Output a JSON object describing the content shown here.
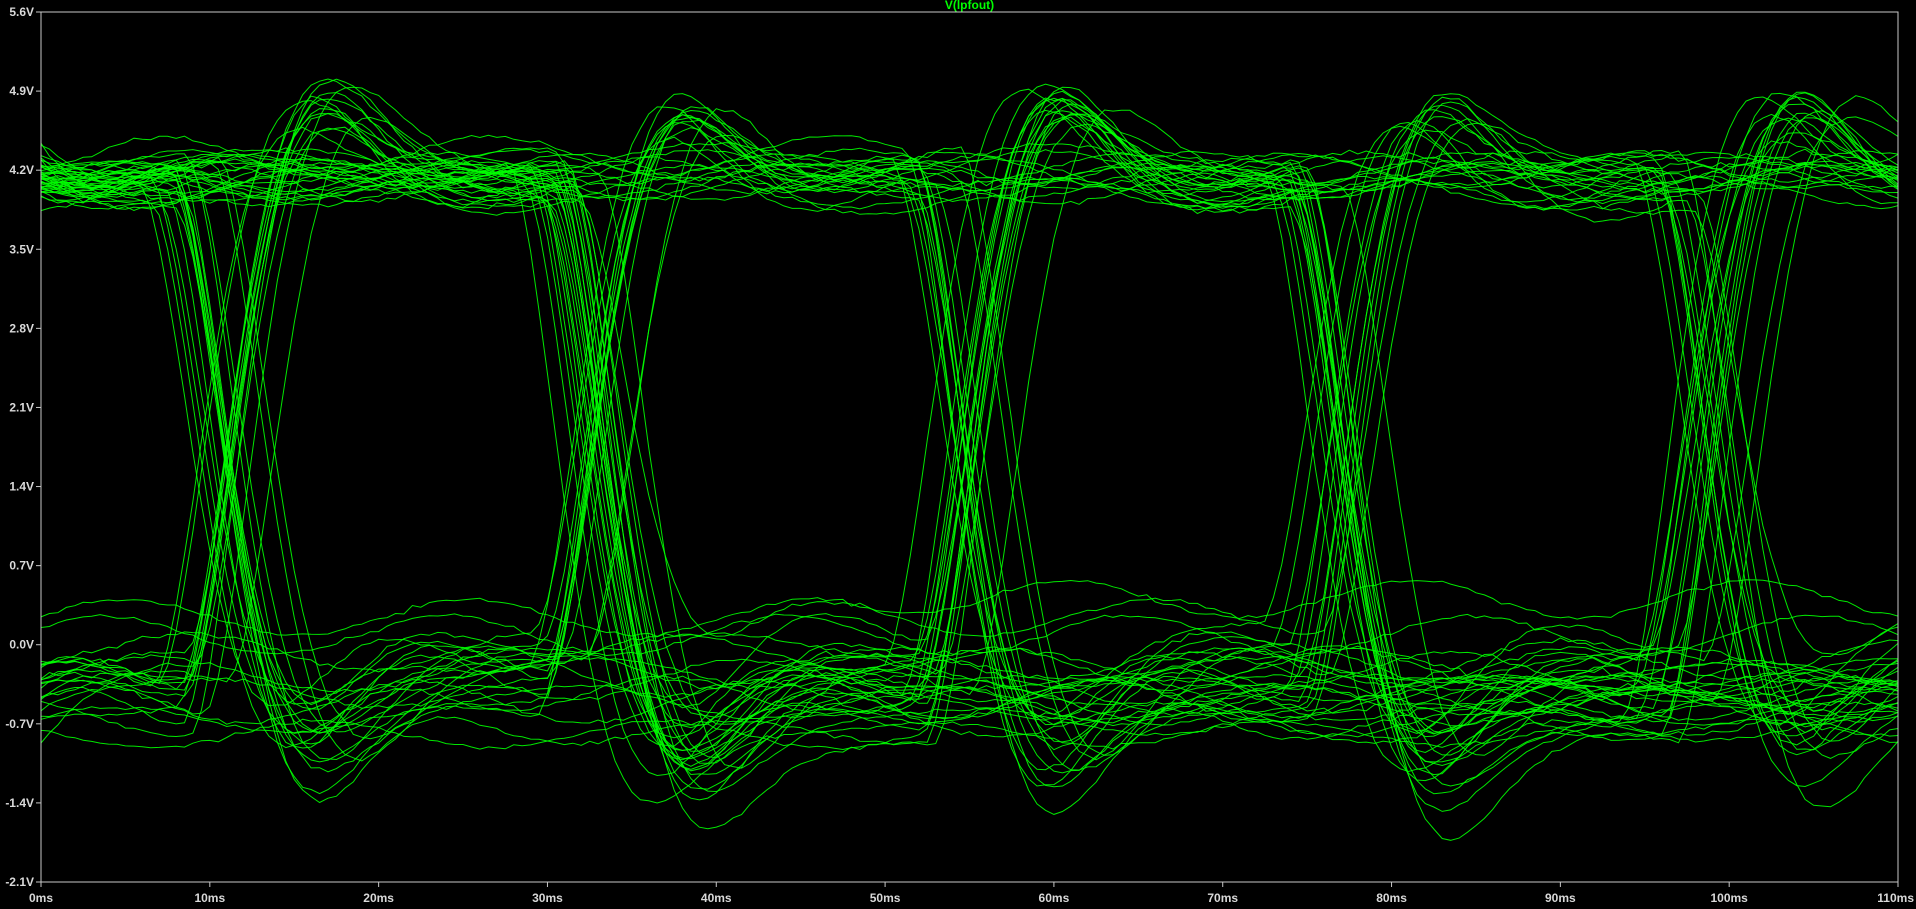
{
  "chart_data": {
    "type": "line",
    "title": "V(lpfout)",
    "xlabel": "",
    "ylabel": "",
    "xlim": [
      0,
      110
    ],
    "ylim": [
      -2.1,
      5.6
    ],
    "x_ticks": [
      0,
      10,
      20,
      30,
      40,
      50,
      60,
      70,
      80,
      90,
      100,
      110
    ],
    "x_tick_labels": [
      "0ms",
      "10ms",
      "20ms",
      "30ms",
      "40ms",
      "50ms",
      "60ms",
      "70ms",
      "80ms",
      "90ms",
      "100ms",
      "110ms"
    ],
    "y_ticks": [
      -2.1,
      -1.4,
      -0.7,
      0.0,
      0.7,
      1.4,
      2.1,
      2.8,
      3.5,
      4.2,
      4.9,
      5.6
    ],
    "y_tick_labels": [
      "-2.1V",
      "-1.4V",
      "-0.7V",
      "0.0V",
      "0.7V",
      "1.4V",
      "2.1V",
      "2.8V",
      "3.5V",
      "4.2V",
      "4.9V",
      "5.6V"
    ],
    "grid": false,
    "legend": "none",
    "x_unit": "ms",
    "y_unit": "V",
    "bit_period_ms": 22,
    "eye_crossings_ms": [
      11,
      33,
      55,
      77,
      99
    ],
    "levels_V": {
      "high_settled": 4.1,
      "high_peak": 5.0,
      "low": -0.2,
      "crossing": 1.95
    },
    "series": [
      {
        "values": [
          [
            0,
            4.9
          ],
          [
            11,
            1.95
          ],
          [
            22,
            4.95
          ],
          [
            33,
            1.95
          ],
          [
            44,
            4.85
          ],
          [
            55,
            1.95
          ],
          [
            66,
            4.95
          ],
          [
            77,
            1.95
          ],
          [
            88,
            4.9
          ],
          [
            99,
            1.95
          ],
          [
            110,
            5.0
          ]
        ]
      },
      {
        "values": [
          [
            0,
            -0.9
          ],
          [
            11,
            1.95
          ],
          [
            22,
            0.0
          ],
          [
            33,
            1.95
          ],
          [
            44,
            -1.3
          ],
          [
            55,
            1.95
          ],
          [
            66,
            -0.3
          ],
          [
            77,
            1.95
          ],
          [
            88,
            -1.2
          ],
          [
            99,
            1.95
          ],
          [
            110,
            -0.4
          ]
        ]
      },
      {
        "values": [
          [
            0,
            4.1
          ],
          [
            22,
            4.15
          ],
          [
            44,
            4.1
          ],
          [
            66,
            4.15
          ],
          [
            88,
            4.1
          ],
          [
            110,
            4.15
          ]
        ]
      },
      {
        "values": [
          [
            0,
            -0.2
          ],
          [
            22,
            -0.1
          ],
          [
            44,
            -0.3
          ],
          [
            66,
            -0.2
          ],
          [
            88,
            -0.1
          ],
          [
            110,
            -0.2
          ]
        ]
      }
    ],
    "colors": {
      "background": "#000000",
      "trace": "#00ff00",
      "axis": "#c8c8c8",
      "tick_text": "#d9d9d9",
      "title_text": "#00ff00"
    },
    "trace_count_estimate": 64,
    "seed": 7
  }
}
